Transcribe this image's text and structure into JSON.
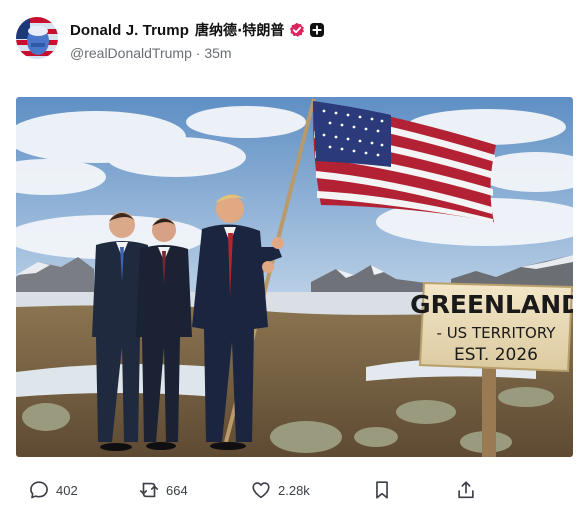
{
  "post": {
    "author": {
      "display_name": "Donald J. Trump",
      "chinese_name": "唐纳德·特朗普",
      "handle": "@realDonaldTrump",
      "time": "35m"
    },
    "image": {
      "sign_lines": [
        "GREENLAND",
        "- US TERRITORY",
        "EST. 2026"
      ]
    },
    "stats": {
      "replies": "402",
      "reposts": "664",
      "likes": "2.28k"
    }
  },
  "colors": {
    "verified_badge": "#e0245e",
    "text_primary": "#111111",
    "text_secondary": "#6b6f75",
    "icon": "#3d4047"
  },
  "icons": [
    "verified-icon",
    "plus-icon",
    "reply-icon",
    "repost-icon",
    "like-icon",
    "bookmark-icon",
    "share-icon"
  ]
}
